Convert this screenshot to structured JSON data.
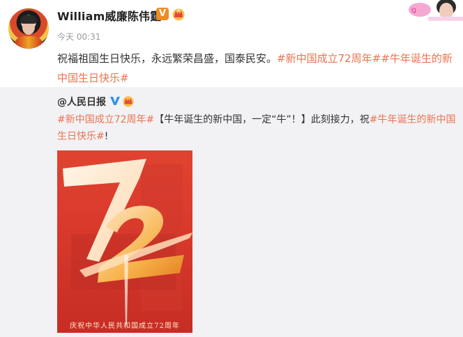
{
  "post": {
    "username": "William威廉陈伟霆",
    "verified_badge": "V",
    "timestamp": "今天 00:31",
    "text_plain": "祝福祖国生日快乐，永远繁荣昌盛，国泰民安。",
    "tag1": "#新中国成立72周年#",
    "tag2": "#牛年诞生的新中国生日快乐#"
  },
  "repost": {
    "username": "@人民日报",
    "tag1": "#新中国成立72周年#",
    "text_mid": "【牛年诞生的新中国，一定“牛”！】此刻接力，祝",
    "tag2": "#牛年诞生的新中国生日快乐#",
    "text_end": "!",
    "poster_caption": "庆祝中华人民共和国成立72周年"
  },
  "icons": {
    "avatar": "avatar",
    "vip_crown": "crown-icon",
    "verified_blue": "blue-v-icon",
    "sticker": "sticker-decoration"
  },
  "colors": {
    "accent_orange": "#eb7350",
    "verified_orange": "#f08a22",
    "verified_blue": "#2f8fe8",
    "repost_bg": "#f2f2f5"
  }
}
